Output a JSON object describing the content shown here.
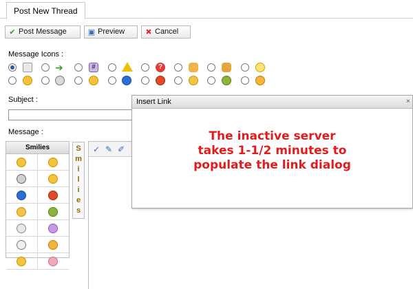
{
  "tab": {
    "label": "Post New Thread"
  },
  "toolbar": {
    "post_message": "Post Message",
    "preview": "Preview",
    "cancel": "Cancel"
  },
  "message_icons": {
    "label": "Message Icons :"
  },
  "subject": {
    "label": "Subject :",
    "value": ""
  },
  "message": {
    "label": "Message :"
  },
  "smilies": {
    "header": "Smilies",
    "vertical_label": "Smilies"
  },
  "dialog": {
    "title": "Insert Link",
    "close_glyph": "×",
    "message_line1": "The inactive server",
    "message_line2": "takes 1-1/2 minutes to",
    "message_line3": "populate the link dialog"
  },
  "colors": {
    "dialog_message": "#e21c1c",
    "vertical_tab_text": "#8a6d00",
    "radio_selected": "#2c5aa0"
  }
}
